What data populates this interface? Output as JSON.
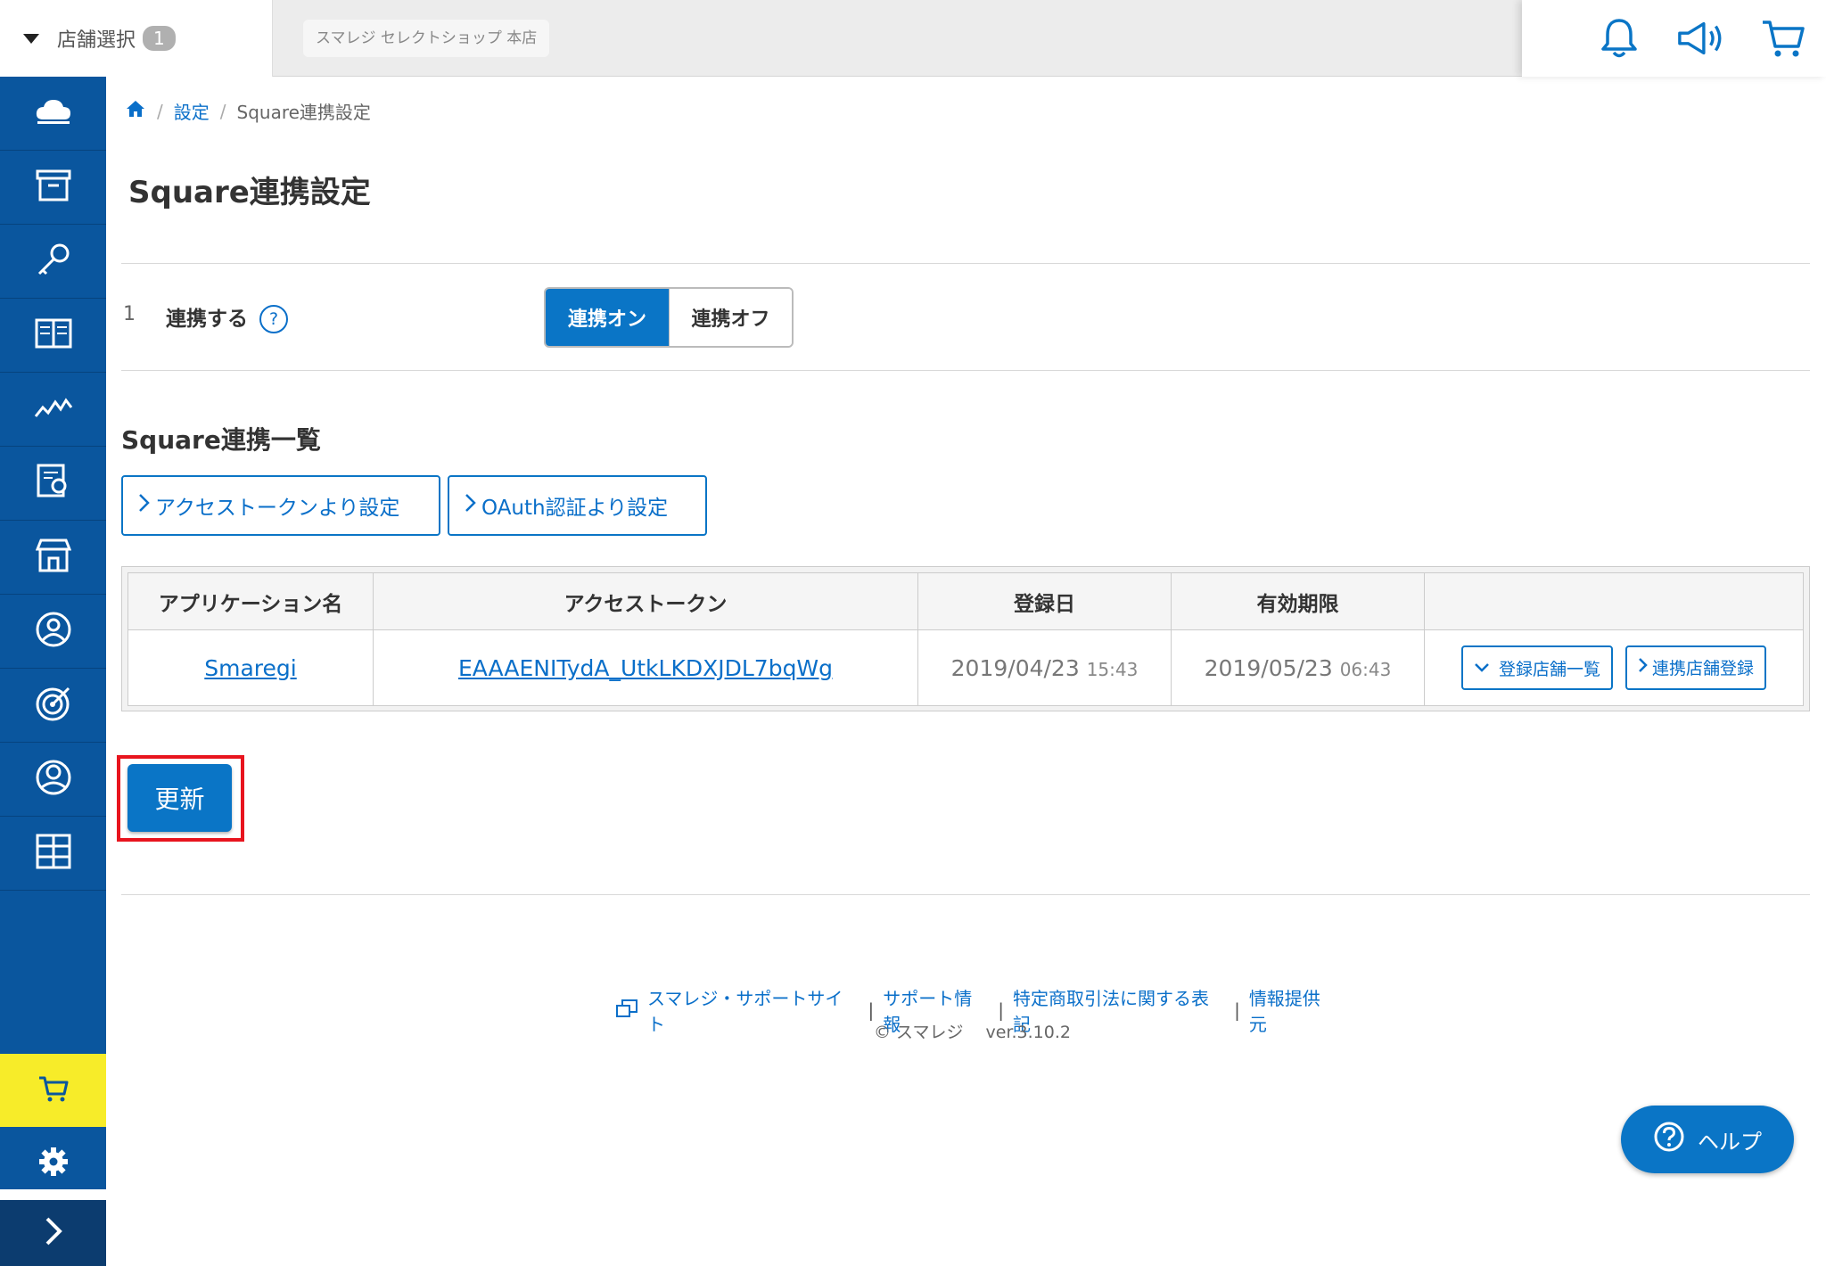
{
  "header": {
    "store_select_label": "店舗選択",
    "store_count": "1",
    "current_store": "スマレジ セレクトショップ 本店"
  },
  "breadcrumb": {
    "settings": "設定",
    "current": "Square連携設定"
  },
  "page": {
    "title": "Square連携設定"
  },
  "setting": {
    "number": "1",
    "label": "連携する",
    "help": "?",
    "on_label": "連携オン",
    "off_label": "連携オフ",
    "selected": "連携オン"
  },
  "list": {
    "title": "Square連携一覧",
    "access_token_button": "アクセストークンより設定",
    "oauth_button": "OAuth認証より設定",
    "columns": [
      "アプリケーション名",
      "アクセストークン",
      "登録日",
      "有効期限",
      ""
    ],
    "rows": [
      {
        "app_name": "Smaregi",
        "token": "EAAAENITydA_UtkLKDXJDL7bqWg",
        "reg_date": "2019/04/23",
        "reg_time": "15:43",
        "exp_date": "2019/05/23",
        "exp_time": "06:43",
        "stores_button": "登録店舗一覧",
        "link_button": "連携店舗登録"
      }
    ]
  },
  "update_button": "更新",
  "footer": {
    "support_site": "スマレジ・サポートサイト",
    "support_info": "サポート情報",
    "legal": "特定商取引法に関する表記",
    "provider": "情報提供元",
    "copyright": "© スマレジ　 ver.3.10.2"
  },
  "help_button": "ヘルプ",
  "colors": {
    "sidebar": "#0a569e",
    "accent": "#0a75c6",
    "cart_highlight": "#f7ec29",
    "highlight_frame": "#e8141e"
  }
}
